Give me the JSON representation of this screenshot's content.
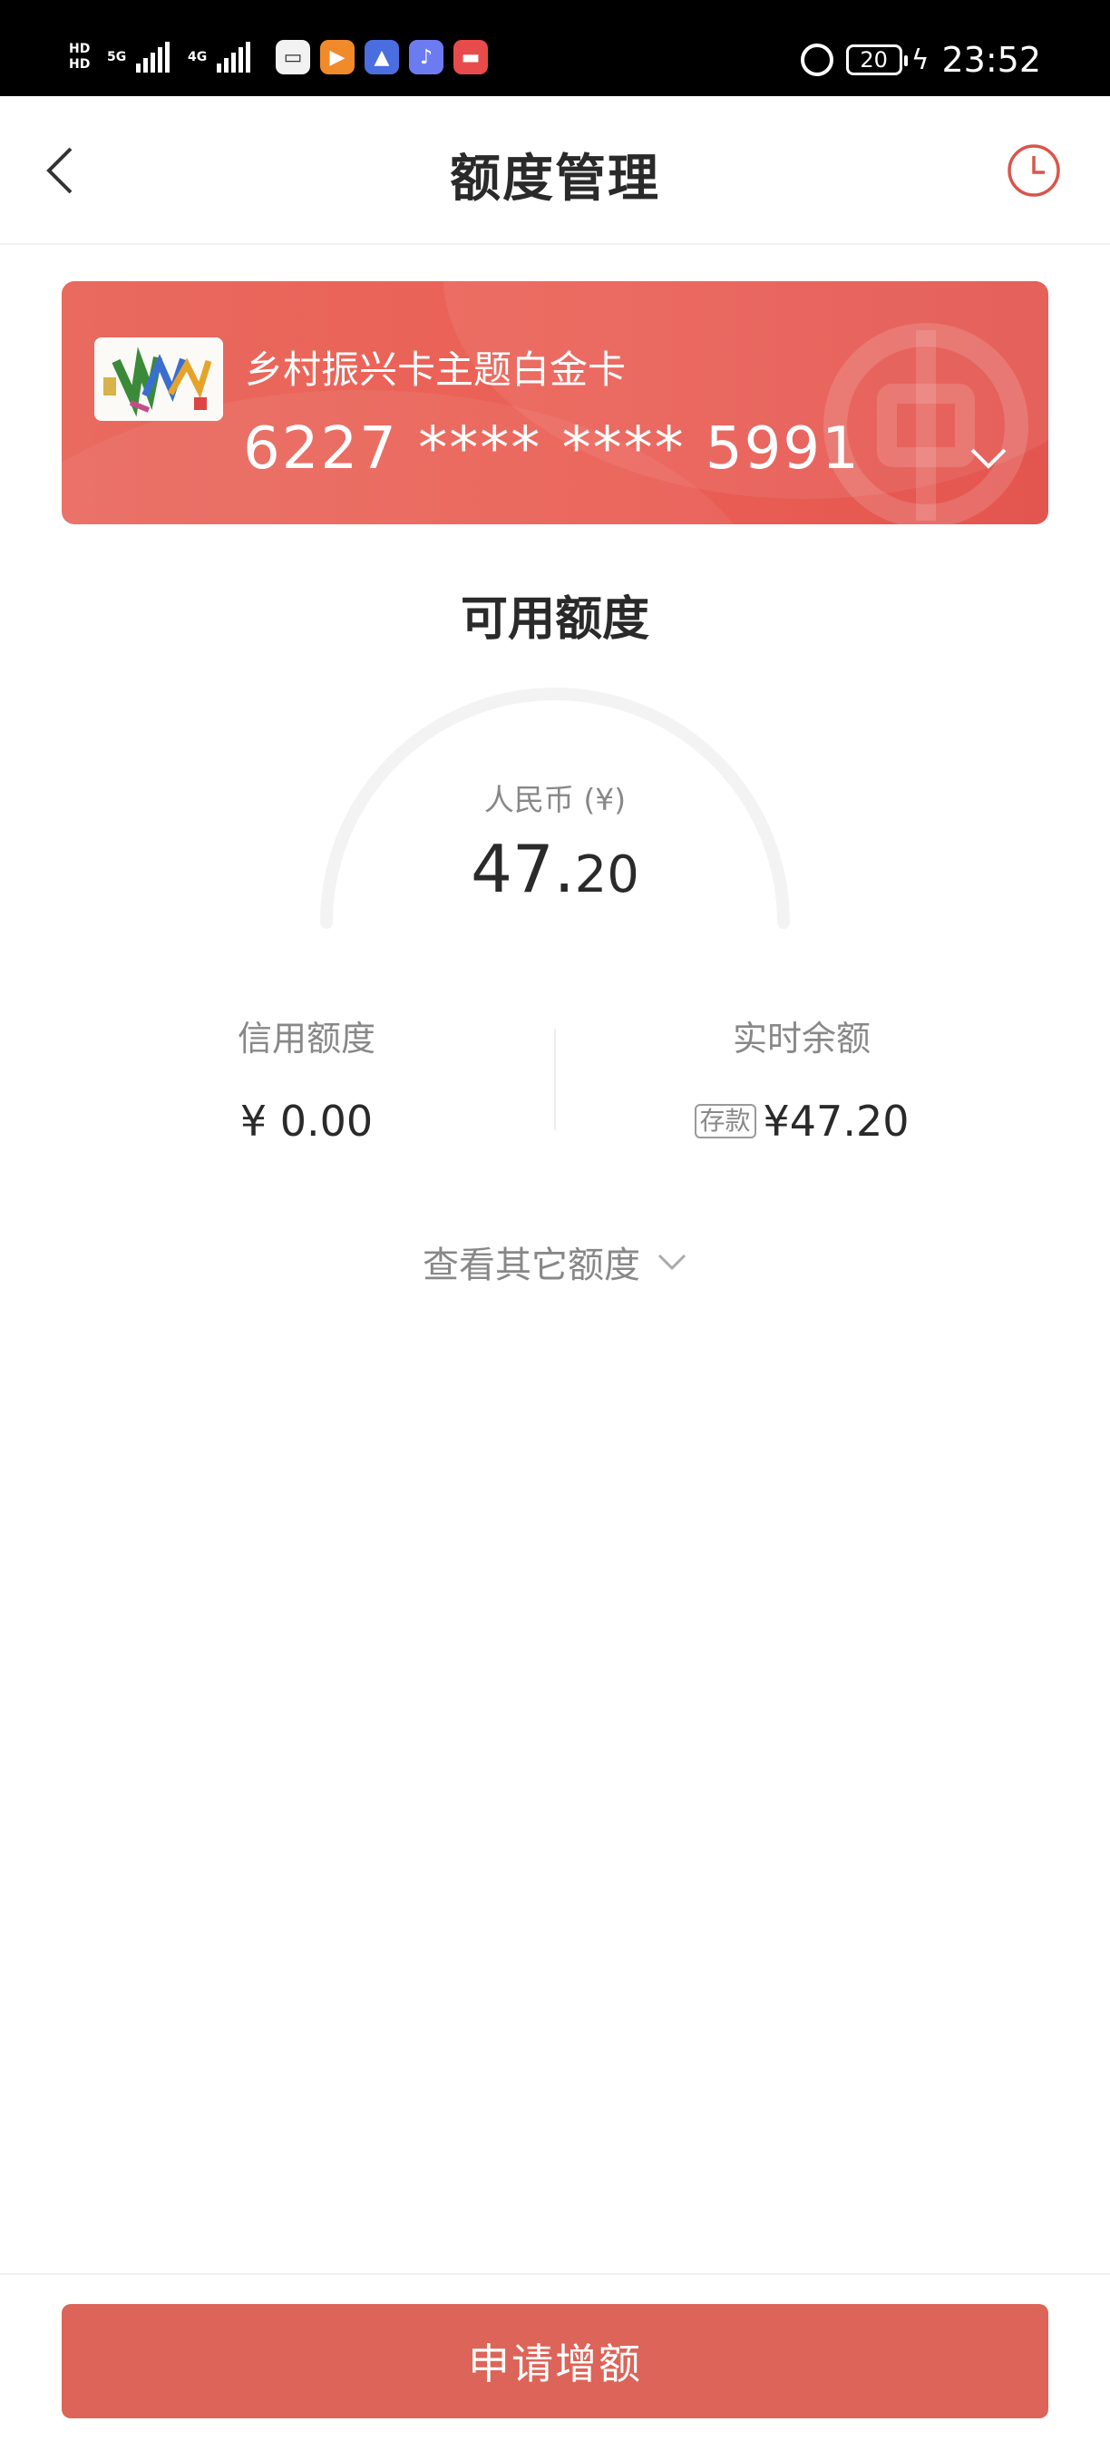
{
  "status_bar": {
    "hd_1": "HD",
    "hd_2": "HD",
    "network_1": "5G",
    "network_2": "4G",
    "battery": "20",
    "time": "23:52",
    "app_icons": [
      "bag-icon",
      "video-icon",
      "education-icon",
      "music-icon",
      "book-icon"
    ]
  },
  "header": {
    "title": "额度管理",
    "back_icon": "chevron-left-icon",
    "history_icon": "clock-icon"
  },
  "card": {
    "name": "乡村振兴卡主题白金卡",
    "number": "6227 **** **** 5991",
    "expand_icon": "chevron-down-icon"
  },
  "available": {
    "title": "可用额度",
    "currency_label": "人民币 (¥)",
    "amount_int": "47.",
    "amount_dec": "20"
  },
  "credit": {
    "label": "信用额度",
    "value": "¥ 0.00"
  },
  "realtime": {
    "label": "实时余额",
    "tag": "存款",
    "value": "¥47.20"
  },
  "more_link": "查看其它额度",
  "apply_button": "申请增额",
  "colors": {
    "accent": "#dc6458",
    "card_bg": "#ea5f55",
    "text_primary": "#2a2a2a",
    "text_secondary": "#888888"
  }
}
